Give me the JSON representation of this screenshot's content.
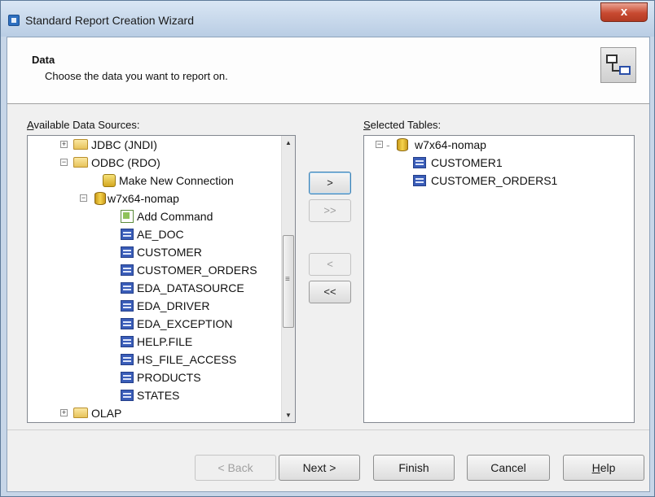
{
  "window": {
    "title": "Standard Report Creation Wizard",
    "close_glyph": "x"
  },
  "header": {
    "title": "Data",
    "subtitle": "Choose the data you want to report on."
  },
  "available": {
    "label_access_key": "A",
    "label_rest": "vailable Data Sources:",
    "items": [
      {
        "label": "JDBC (JNDI)",
        "expander": "+"
      },
      {
        "label": "ODBC (RDO)",
        "expander": "−"
      },
      {
        "label": "Make New Connection"
      },
      {
        "label": "w7x64-nomap",
        "expander": "−"
      },
      {
        "label": "Add Command"
      },
      {
        "label": "AE_DOC"
      },
      {
        "label": "CUSTOMER"
      },
      {
        "label": "CUSTOMER_ORDERS"
      },
      {
        "label": "EDA_DATASOURCE"
      },
      {
        "label": "EDA_DRIVER"
      },
      {
        "label": "EDA_EXCEPTION"
      },
      {
        "label": "HELP.FILE"
      },
      {
        "label": "HS_FILE_ACCESS"
      },
      {
        "label": "PRODUCTS"
      },
      {
        "label": "STATES"
      },
      {
        "label": "OLAP",
        "expander": "+"
      }
    ]
  },
  "selected": {
    "label_access_key": "S",
    "label_rest": "elected Tables:",
    "items": [
      {
        "label": "w7x64-nomap",
        "expander": "−"
      },
      {
        "label": "CUSTOMER1"
      },
      {
        "label": "CUSTOMER_ORDERS1"
      }
    ]
  },
  "transfer": {
    "add_one": ">",
    "add_all": ">>",
    "remove_one": "<",
    "remove_all": "<<"
  },
  "footer": {
    "back": "< Back",
    "next": "Next >",
    "finish": "Finish",
    "cancel": "Cancel",
    "help_access_key": "H",
    "help_rest": "elp"
  }
}
